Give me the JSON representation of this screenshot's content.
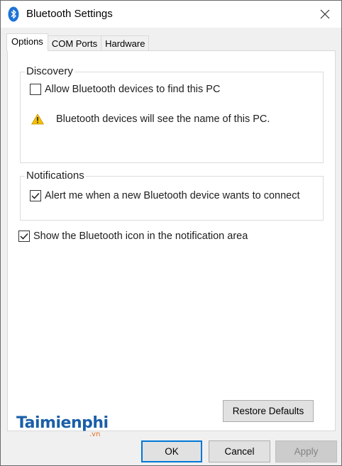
{
  "window": {
    "title": "Bluetooth Settings"
  },
  "tabs": [
    {
      "label": "Options",
      "active": true
    },
    {
      "label": "COM Ports",
      "active": false
    },
    {
      "label": "Hardware",
      "active": false
    }
  ],
  "discovery": {
    "group_label": "Discovery",
    "allow_find_label": "Allow Bluetooth devices to find this PC",
    "allow_find_checked": false,
    "warning_text": "Bluetooth devices will see the name of this PC."
  },
  "notifications": {
    "group_label": "Notifications",
    "alert_label": "Alert me when a new Bluetooth device wants to connect",
    "alert_checked": true
  },
  "show_icon": {
    "label": "Show the Bluetooth icon in the notification area",
    "checked": true
  },
  "buttons": {
    "restore_defaults": "Restore Defaults",
    "ok": "OK",
    "cancel": "Cancel",
    "apply": "Apply"
  },
  "watermark": {
    "brand": "Taimienphi",
    "suffix": ".vn"
  },
  "colors": {
    "accent": "#0078d7",
    "warning": "#f5c000",
    "watermark_blue": "#1b5fa8",
    "watermark_orange": "#e0702a"
  }
}
